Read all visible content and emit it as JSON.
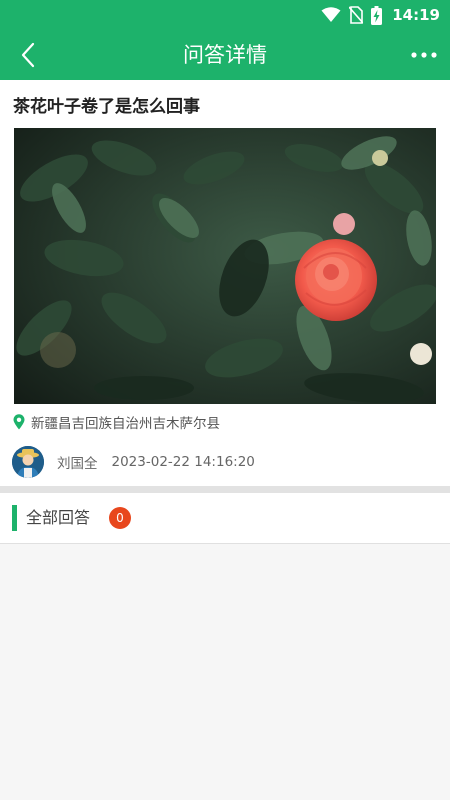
{
  "status_bar": {
    "time": "14:19",
    "icons": [
      "wifi-icon",
      "no-sim-icon",
      "battery-charging-icon"
    ]
  },
  "header": {
    "title": "问答详情",
    "back_icon": "chevron-left-icon",
    "more_icon": "more-horizontal-icon"
  },
  "question": {
    "title": "茶花叶子卷了是怎么回事",
    "location": "新疆昌吉回族自治州吉木萨尔县",
    "location_icon": "map-pin-icon",
    "author": "刘国全",
    "time": "2023-02-22 14:16:20"
  },
  "answers": {
    "label": "全部回答",
    "count": "0"
  },
  "colors": {
    "brand_green": "#1db26b",
    "badge_red": "#e8471d",
    "flower_red": "#f25a4b"
  }
}
